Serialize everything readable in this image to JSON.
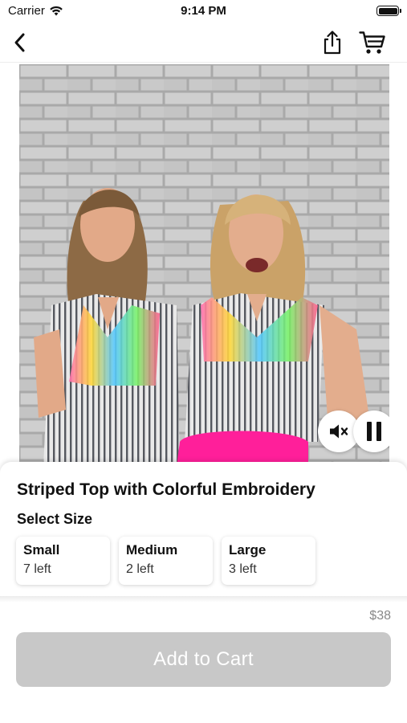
{
  "status_bar": {
    "carrier": "Carrier",
    "time": "9:14 PM"
  },
  "nav": {
    "back_icon": "chevron-left-icon",
    "share_icon": "share-icon",
    "cart_icon": "shopping-cart-icon"
  },
  "video": {
    "mute_icon": "volume-mute-icon",
    "pause_icon": "pause-icon",
    "colors": {
      "pink": "#ff1f9a",
      "brick": "#c9c9c9"
    }
  },
  "product": {
    "title": "Striped Top with Colorful Embroidery",
    "select_size_label": "Select Size",
    "sizes": [
      {
        "name": "Small",
        "stock": "7 left"
      },
      {
        "name": "Medium",
        "stock": "2 left"
      },
      {
        "name": "Large",
        "stock": "3 left"
      }
    ],
    "price": "$38"
  },
  "cart": {
    "add_label": "Add to Cart",
    "disabled_color": "#c8c8c8"
  }
}
